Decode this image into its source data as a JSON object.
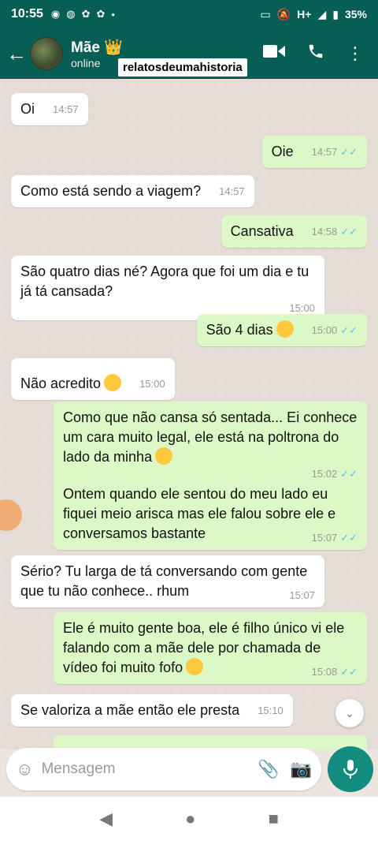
{
  "statusbar": {
    "time": "10:55",
    "left_icons": [
      "whatsapp-icon",
      "messenger-icon",
      "app-icon",
      "app-icon",
      "dot"
    ],
    "network": "H+",
    "battery": "35%"
  },
  "header": {
    "contact_name": "Mãe 👑",
    "contact_status": "online",
    "watermark": "relatosdeumahistoria"
  },
  "messages": [
    {
      "dir": "in",
      "text": "Oi",
      "time": "14:57"
    },
    {
      "dir": "out",
      "text": "Oie",
      "time": "14:57"
    },
    {
      "dir": "in",
      "text": "Como está sendo a viagem?",
      "time": "14:57"
    },
    {
      "dir": "out",
      "text": "Cansativa",
      "time": "14:58"
    },
    {
      "dir": "in",
      "text": "São quatro dias né? Agora que foi um dia e tu já tá cansada?",
      "time": "15:00"
    },
    {
      "dir": "out",
      "text": "São 4 dias",
      "time": "15:00"
    },
    {
      "dir": "in",
      "text": "Não acredito",
      "time": "15:00"
    },
    {
      "dir": "out",
      "text": "Como que não cansa só sentada... Ei conhece um cara muito legal, ele está na poltrona do lado da minha",
      "time": "15:02"
    },
    {
      "dir": "out",
      "text": "Ontem quando ele sentou do meu lado eu fiquei meio arisca mas ele falou sobre ele e conversamos bastante",
      "time": "15:07"
    },
    {
      "dir": "in",
      "text": "Sério? Tu larga de tá conversando com gente que tu não conhece.. rhum",
      "time": "15:07"
    },
    {
      "dir": "out",
      "text": "Ele é muito gente boa, ele é filho único vi ele falando com a mãe dele por chamada de vídeo foi muito fofo",
      "time": "15:08"
    },
    {
      "dir": "in",
      "text": "Se valoriza a mãe então ele presta",
      "time": "15:10"
    }
  ],
  "input": {
    "placeholder": "Mensagem"
  }
}
